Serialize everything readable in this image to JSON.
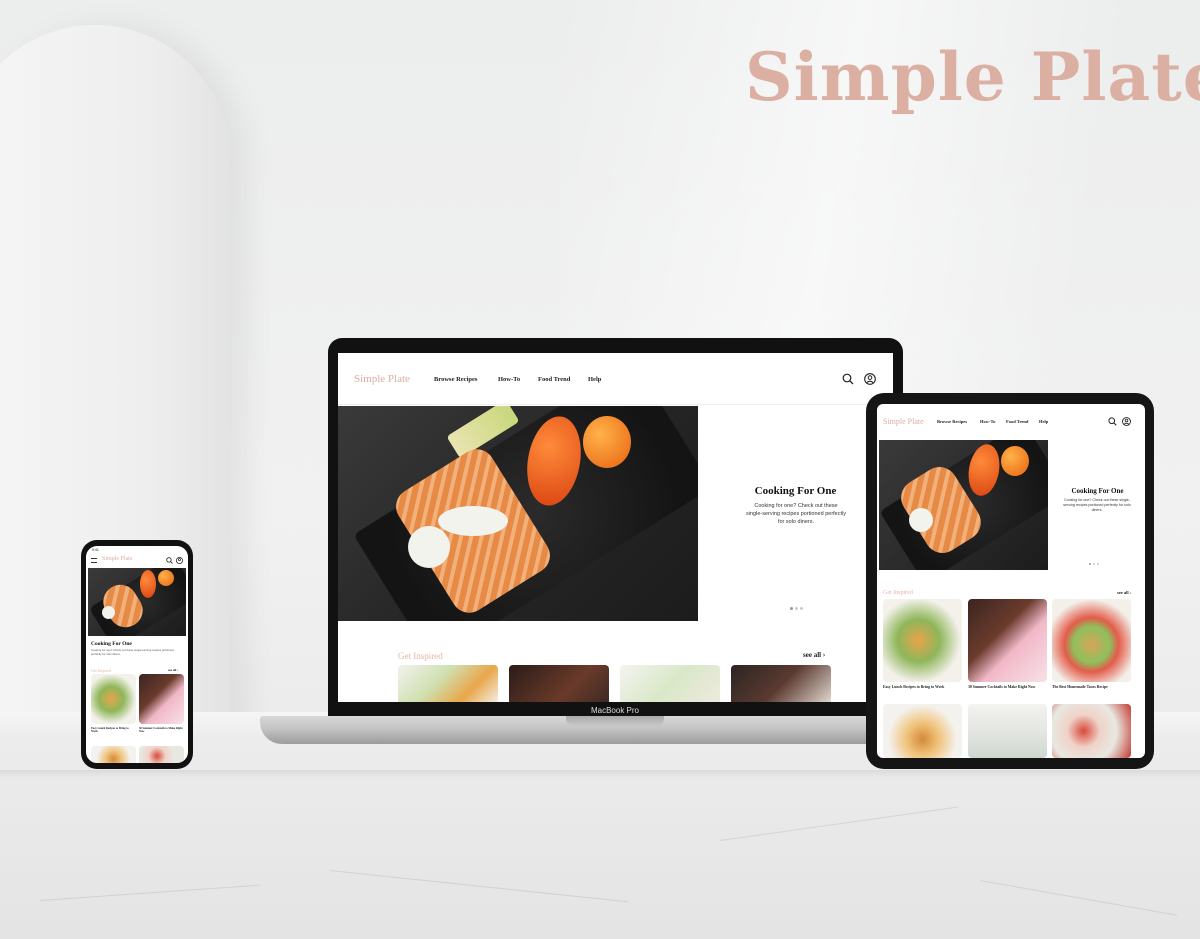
{
  "brand": {
    "title": "Simple Plate",
    "accent_color": "#dbb0a2"
  },
  "site": {
    "logo": "Simple Plate",
    "nav": [
      "Browse Recipes",
      "How-To",
      "Food Trend",
      "Help"
    ],
    "icons": [
      "search-icon",
      "account-icon"
    ],
    "hero": {
      "title": "Cooking For One",
      "body": "Cooking for one? Check out these single-serving recipes portioned perfectly for solo diners.",
      "carousel_position": 1,
      "carousel_total": 3
    },
    "section": {
      "title": "Get Inspired",
      "see_all": "see all"
    },
    "cards": [
      "Easy Lunch Recipes to Bring to Work",
      "30 Summer Cocktails to Make Right Now",
      "The Best Homemade Tacos Recipe"
    ]
  },
  "devices": {
    "laptop_label": "MacBook Pro",
    "phone_time": "9:41"
  }
}
